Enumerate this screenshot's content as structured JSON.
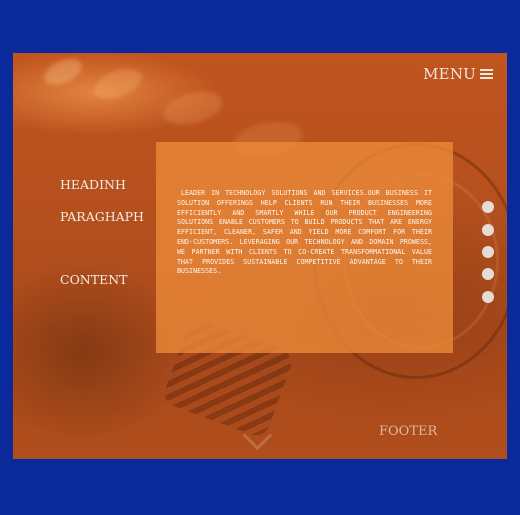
{
  "header": {
    "menu_label": "MENU",
    "menu_icon": "hamburger-icon"
  },
  "nav": {
    "items": [
      {
        "label": "HEADINH"
      },
      {
        "label": "PARAGHAPH"
      },
      {
        "label": "CONTENT"
      }
    ]
  },
  "panel": {
    "text": "LEADER IN TECHNOLOGY SOLUTIONS AND SERVICES.OUR BUSINESS IT SOLUTION OFFERINGS HELP CLIENTS RUN THEIR BUSINESSES MORE EFFICIENTLY AND SMARTLY WHILE OUR PRODUCT ENGINEERING SOLUTIONS ENABLE CUSTOMERS TO BUILD PRODUCTS THAT ARE ENERGY EFFICIENT, CLEANER, SAFER AND YIELD MORE COMFORT FOR THEIR END-CUSTOMERS. LEVERAGING OUR TECHNOLOGY AND DOMAIN PROWESS, WE PARTNER WITH CLIENTS TO CO-CREATE TRANSFORMATIONAL VALUE THAT PROVIDES SUSTAINABLE COMPETITIVE ADVANTAGE TO THEIR BUSINESSES."
  },
  "pager": {
    "count": 5
  },
  "footer": {
    "label": "FOOTER"
  },
  "colors": {
    "page_background": "#0a2a9c",
    "hero_background": "#b4501e",
    "panel_background": "#ec8a3a",
    "text_light": "#f5ece4",
    "dot": "#e6dcd6"
  }
}
